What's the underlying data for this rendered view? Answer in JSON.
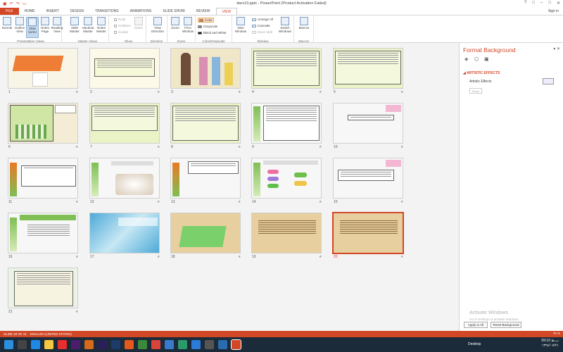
{
  "window": {
    "title": "dars13.pptx - PowerPoint (Product Activation Failed)",
    "controls": [
      "?",
      "□",
      "–",
      "□",
      "✕"
    ]
  },
  "qat": [
    "save-icon",
    "undo-icon",
    "redo-icon",
    "start-icon"
  ],
  "tabs": [
    "FILE",
    "HOME",
    "INSERT",
    "DESIGN",
    "TRANSITIONS",
    "ANIMATIONS",
    "SLIDE SHOW",
    "REVIEW",
    "VIEW"
  ],
  "active_tab": "VIEW",
  "signin": "Sign in",
  "ribbon": {
    "presentation_views": {
      "label": "Presentation Views",
      "buttons": [
        "Normal",
        "Outline View",
        "Slide Sorter",
        "Notes Page",
        "Reading View"
      ]
    },
    "master_views": {
      "label": "Master Views",
      "buttons": [
        "Slide Master",
        "Handout Master",
        "Notes Master"
      ]
    },
    "show": {
      "label": "Show",
      "items": [
        "Ruler",
        "Gridlines",
        "Guides"
      ],
      "notes": "Notes"
    },
    "direction": {
      "label": "Direction",
      "button": "View Direction"
    },
    "zoom": {
      "label": "Zoom",
      "buttons": [
        "Zoom",
        "Fit to Window"
      ]
    },
    "color": {
      "label": "Color/Grayscale",
      "items": [
        "Color",
        "Grayscale",
        "Black and White"
      ]
    },
    "window": {
      "label": "Window",
      "new": "New Window",
      "items": [
        "Arrange All",
        "Cascade",
        "Move Split"
      ],
      "switch": "Switch Windows"
    },
    "macros": {
      "label": "Macros",
      "button": "Macros"
    }
  },
  "slides": [
    "1",
    "2",
    "3",
    "4",
    "5",
    "6",
    "7",
    "8",
    "9",
    "10",
    "11",
    "12",
    "13",
    "14",
    "15",
    "16",
    "17",
    "18",
    "19",
    "20",
    "21"
  ],
  "selected_slide": "20",
  "panel": {
    "title": "Format Background",
    "section": "ARTISTIC EFFECTS",
    "label": "Artistic Effects",
    "reset": "Reset",
    "apply_all": "Apply to All",
    "reset_bg": "Reset Background"
  },
  "activation": {
    "title": "Activate Windows",
    "sub": "Go to Settings to activate Windows."
  },
  "status": {
    "slide": "SLIDE 20 OF 21",
    "lang": "ENGLISH (UNITED STATES)",
    "zoom": "75 %"
  },
  "taskbar": {
    "desktop": "Desktop",
    "time": "09:10 ب.ظ",
    "date": "۱۳۹۶/۰۷/۲۱"
  },
  "colors": {
    "accent": "#d24726",
    "taskbar": "#1c2b39"
  }
}
